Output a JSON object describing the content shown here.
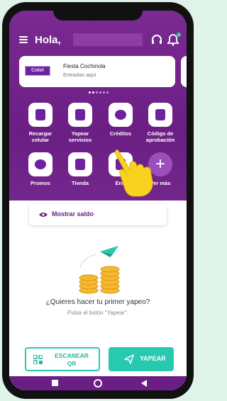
{
  "header": {
    "greeting": "Hola,"
  },
  "event": {
    "logo_text": "Cotol",
    "title": "Fiesta Cochinola",
    "subtitle": "Entradas aquí"
  },
  "services": [
    {
      "label": "Recargar\ncelular",
      "icon": "phone-icon"
    },
    {
      "label": "Yapear\nservicios",
      "icon": "receipt-icon"
    },
    {
      "label": "Créditos",
      "icon": "wallet-icon"
    },
    {
      "label": "Código de\naprobación",
      "icon": "shop-bag-icon"
    },
    {
      "label": "Promos",
      "icon": "promo-icon"
    },
    {
      "label": "Tienda",
      "icon": "store-icon"
    },
    {
      "label": "Entr",
      "icon": "ticket-icon"
    },
    {
      "label": "Ver más",
      "icon": "plus-icon"
    }
  ],
  "balance": {
    "label": "Mostrar saldo"
  },
  "empty_state": {
    "question": "¿Quieres hacer tu primer yapeo?",
    "hint": "Pulsa el botón \"Yapear\"."
  },
  "actions": {
    "scan_label": "ESCANEAR\nQR",
    "pay_label": "YAPEAR"
  },
  "colors": {
    "primary": "#6b1f84",
    "accent": "#27c9b0",
    "coin": "#f5b82e"
  }
}
